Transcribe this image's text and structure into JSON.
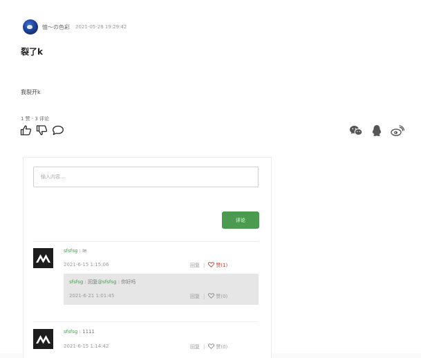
{
  "post": {
    "author": "憶～の色彩",
    "time": "2021-05-28 19:29:42",
    "title": "裂了k",
    "body": "我裂开k",
    "stats": "1 赞 · 3 评论"
  },
  "icons": {
    "actions": [
      "thumb-up-icon",
      "thumb-down-icon",
      "comment-bubble-icon"
    ],
    "share": [
      "wechat-icon",
      "qq-icon",
      "weibo-icon"
    ]
  },
  "comment_form": {
    "placeholder": "输入内容...",
    "submit_label": "评论"
  },
  "comments": [
    {
      "user": "sfsfsg",
      "sep": " : ",
      "text": "Ie",
      "time": "2021-6-15 1:15:06",
      "reply_label": "回复",
      "bar": "|",
      "like_label": "赞(1)",
      "replies": [
        {
          "user": "sfsfsg",
          "sep": " : ",
          "reply_word": "回复",
          "target": "@sfsfsg",
          "text": " : 你好吗",
          "time": "2021-6-21 1:01:45",
          "reply_label": "回复",
          "bar": "|",
          "like_label": "赞(0)"
        }
      ]
    },
    {
      "user": "sfsfsg",
      "sep": " : ",
      "text": "1111",
      "time": "2021-6-15 1:14:42",
      "reply_label": "回复",
      "bar": "|",
      "like_label": "赞(0)"
    }
  ],
  "colors": {
    "accent_green": "#4a9a50",
    "liked_red": "#c0392b",
    "reply_bg": "#e6e6e6"
  }
}
